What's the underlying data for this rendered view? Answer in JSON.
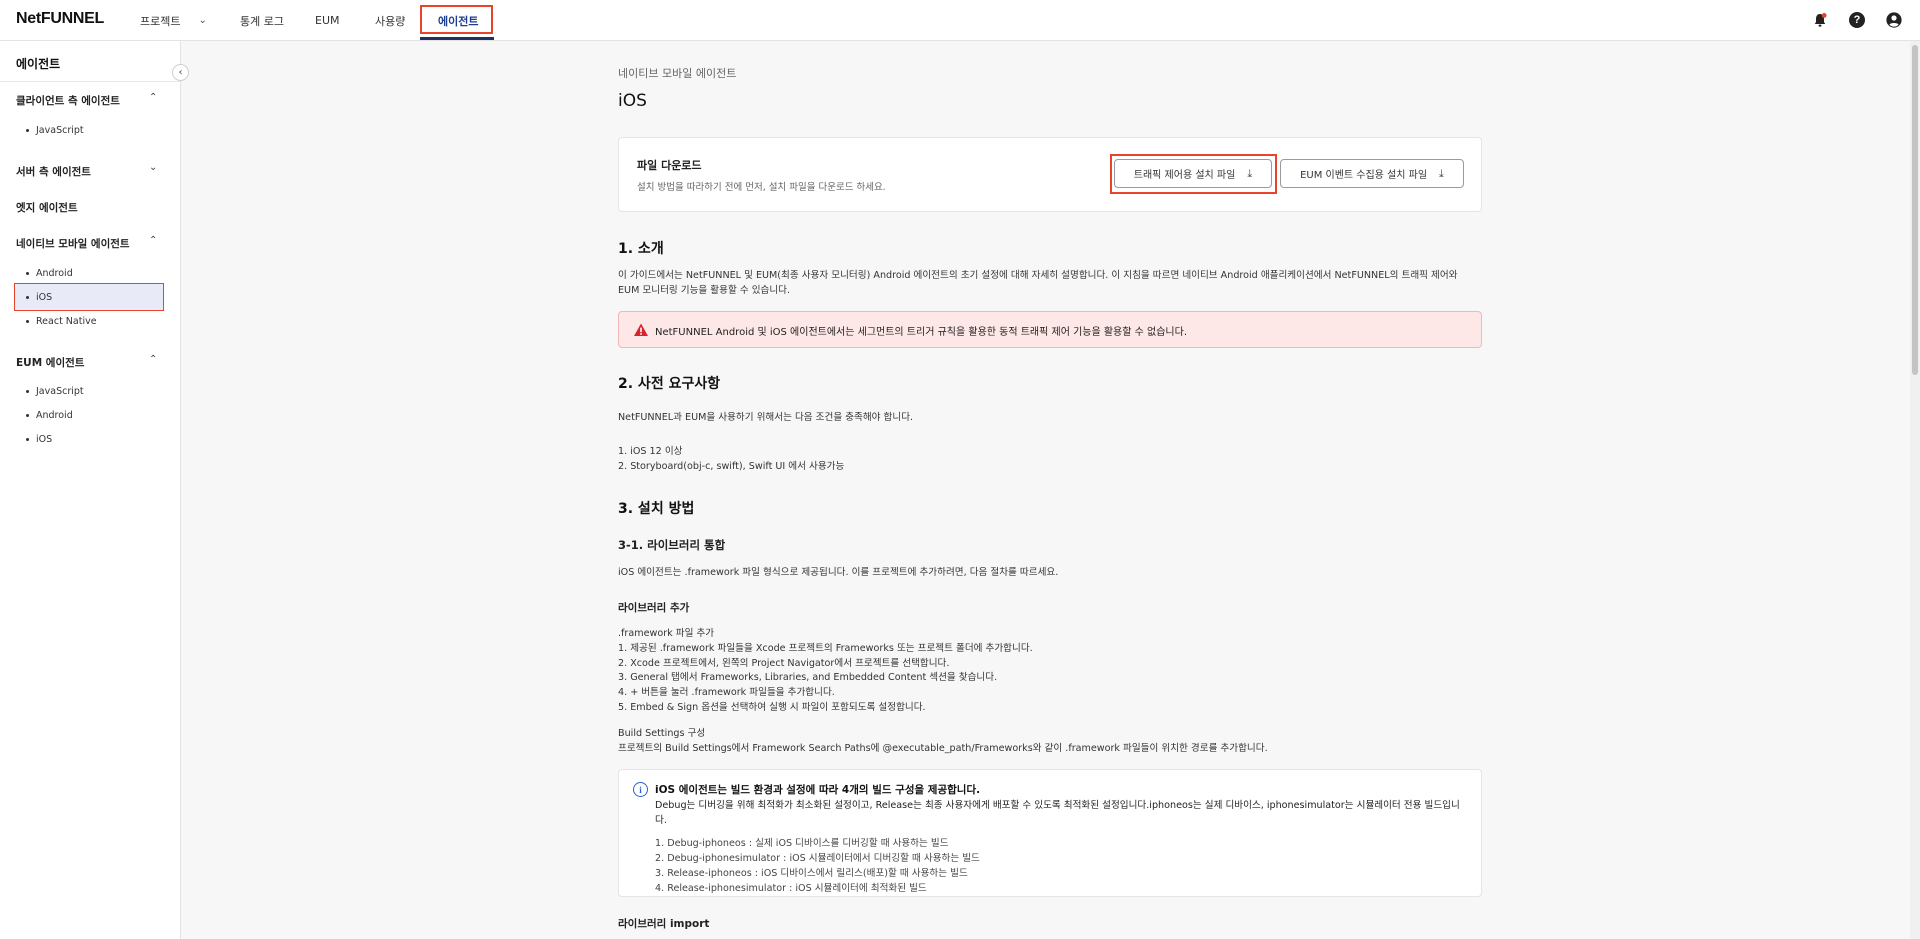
{
  "header": {
    "logo": "NetFUNNEL",
    "nav": [
      {
        "label": "프로젝트",
        "has_dropdown": true
      },
      {
        "label": "통계 로그"
      },
      {
        "label": "EUM"
      },
      {
        "label": "사용량"
      },
      {
        "label": "에이전트",
        "active": true
      }
    ],
    "icons": [
      "bell-icon",
      "help-icon",
      "account-icon"
    ],
    "help_glyph": "?"
  },
  "sidebar": {
    "title": "에이전트",
    "groups": [
      {
        "label": "클라이언트 측 에이전트",
        "expanded": true,
        "items": [
          "JavaScript"
        ]
      },
      {
        "label": "서버 측 에이전트",
        "expanded": false,
        "items": []
      },
      {
        "label": "엣지 에이전트",
        "expanded": false,
        "items": []
      },
      {
        "label": "네이티브 모바일 에이전트",
        "expanded": true,
        "items": [
          "Android",
          "iOS",
          "React Native"
        ],
        "selected": "iOS"
      },
      {
        "label": "EUM 에이전트",
        "expanded": true,
        "items": [
          "JavaScript",
          "Android",
          "iOS"
        ]
      }
    ]
  },
  "main": {
    "breadcrumb": "네이티브 모바일 에이전트",
    "title": "iOS",
    "download": {
      "title": "파일 다운로드",
      "subtitle": "설치 방법을 따라하기 전에 먼저, 설치 파일을 다운로드 하세요.",
      "buttons": [
        "트래픽 제어용 설치 파일",
        "EUM 이벤트 수집용 설치 파일"
      ]
    },
    "intro": {
      "heading": "1. 소개",
      "line1": "이 가이드에서는 NetFUNNEL 및 EUM(최종 사용자 모니터링) Android 에이전트의 초기 설정에 대해 자세히 설명합니다. 이 지침을 따르면 네이티브 Android 애플리케이션에서 NetFUNNEL의 트래픽 제어와",
      "line2": "EUM 모니터링 기능을 활용할 수 있습니다.",
      "warning": "NetFUNNEL Android 및 iOS 에이전트에서는 세그먼트의 트리거 규칙을 활용한 동적 트래픽 제어 기능을 활용할 수 없습니다."
    },
    "prereq": {
      "heading": "2. 사전 요구사항",
      "text": "NetFUNNEL과 EUM을 사용하기 위해서는 다음 조건을 충족해야 합니다.",
      "items": [
        "1. iOS 12 이상",
        "2. Storyboard(obj-c, swift), Swift UI 에서 사용가능"
      ]
    },
    "install": {
      "heading": "3. 설치 방법",
      "sub_heading": "3-1. 라이브러리 통합",
      "sub_text": "iOS 에이전트는 .framework 파일 형식으로 제공됩니다. 이를 프로젝트에 추가하려면, 다음 절차를 따르세요.",
      "add_heading": "라이브러리 추가",
      "add_label": ".framework 파일 추가",
      "add_steps": [
        "1. 제공된 .framework 파일들을 Xcode 프로젝트의 Frameworks 또는 프로젝트 폴더에 추가합니다.",
        "2. Xcode 프로젝트에서, 왼쪽의 Project Navigator에서 프로젝트를 선택합니다.",
        "3. General 탭에서 Frameworks, Libraries, and Embedded Content 섹션을 찾습니다.",
        "4. + 버튼을 눌러 .framework 파일들을 추가합니다.",
        "5. Embed & Sign 옵션을 선택하여 실행 시 파일이 포함되도록 설정합니다."
      ],
      "build_label": "Build Settings 구성",
      "build_text": "프로젝트의 Build Settings에서 Framework Search Paths에 @executable_path/Frameworks와 같이 .framework 파일들이 위치한 경로를 추가합니다.",
      "info": {
        "icon_glyph": "i",
        "title": "iOS 에이전트는 빌드 환경과 설정에 따라 4개의 빌드 구성을 제공합니다.",
        "desc": "Debug는 디버깅을 위해 최적화가 최소화된 설정이고, Release는 최종 사용자에게 배포할 수 있도록 최적화된 설정입니다.iphoneos는 실제 디바이스, iphonesimulator는 시뮬레이터 전용 빌드입니다.",
        "items": [
          "1. Debug-iphoneos : 실제 iOS 디바이스를 디버깅할 때 사용하는 빌드",
          "2. Debug-iphonesimulator : iOS 시뮬레이터에서 디버깅할 때 사용하는 빌드",
          "3. Release-iphoneos : iOS 디바이스에서 릴리스(배포)할 때 사용하는 빌드",
          "4. Release-iphonesimulator : iOS 시뮬레이터에 최적화된 빌드"
        ]
      },
      "import_heading": "라이브러리 import"
    }
  },
  "colors": {
    "accent": "#1c3d8f",
    "highlight": "#e8442c",
    "warning_bg": "#fde7e7",
    "info": "#2d5fd6"
  }
}
